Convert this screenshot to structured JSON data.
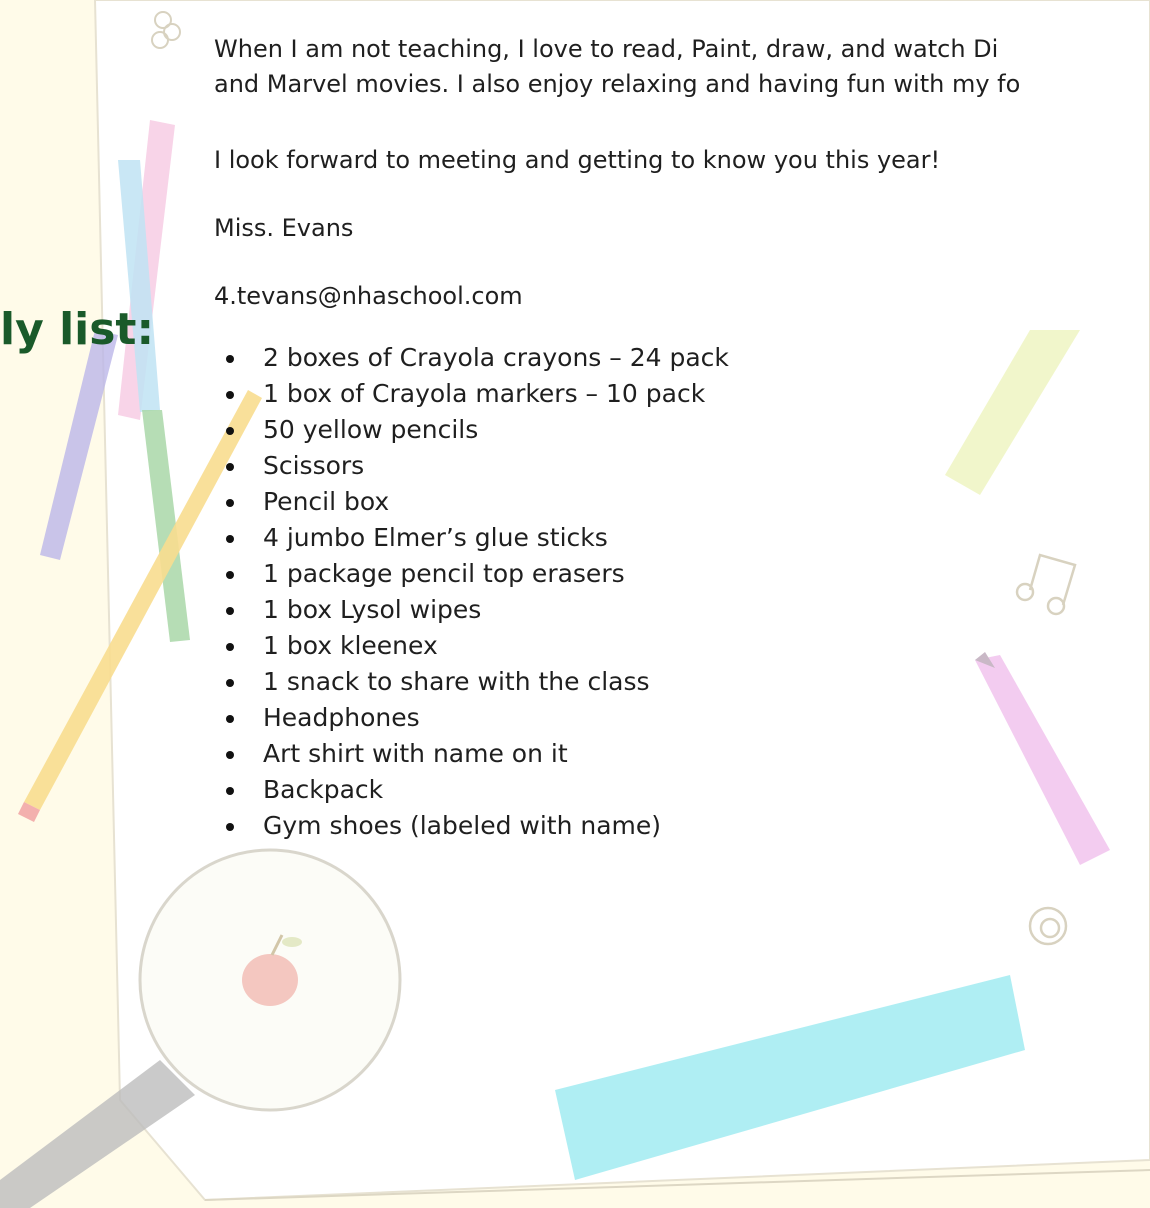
{
  "letter": {
    "paragraph_line1": "When I am not teaching, I love to read, Paint, draw, and watch Di",
    "paragraph_line2": "and Marvel movies. I also enjoy relaxing and having fun with my fo",
    "closing": "I look forward to meeting and getting to know you this year!",
    "signature": "Miss. Evans",
    "email": "4.tevans@nhaschool.com"
  },
  "supply_heading": "ly list:",
  "supply_list": [
    "2 boxes of Crayola crayons – 24 pack",
    "1 box of Crayola markers – 10 pack",
    "50 yellow pencils",
    "Scissors",
    "Pencil box",
    "4 jumbo Elmer’s glue sticks",
    "1 package pencil top erasers",
    "1 box Lysol wipes",
    "1 box kleenex",
    "1 snack to share with the class",
    "Headphones",
    "Art shirt with name on it",
    "Backpack",
    "Gym shoes (labeled with name)"
  ],
  "colors": {
    "heading": "#1a5a2a",
    "background": "#fffbe6",
    "paper": "#ffffff"
  }
}
